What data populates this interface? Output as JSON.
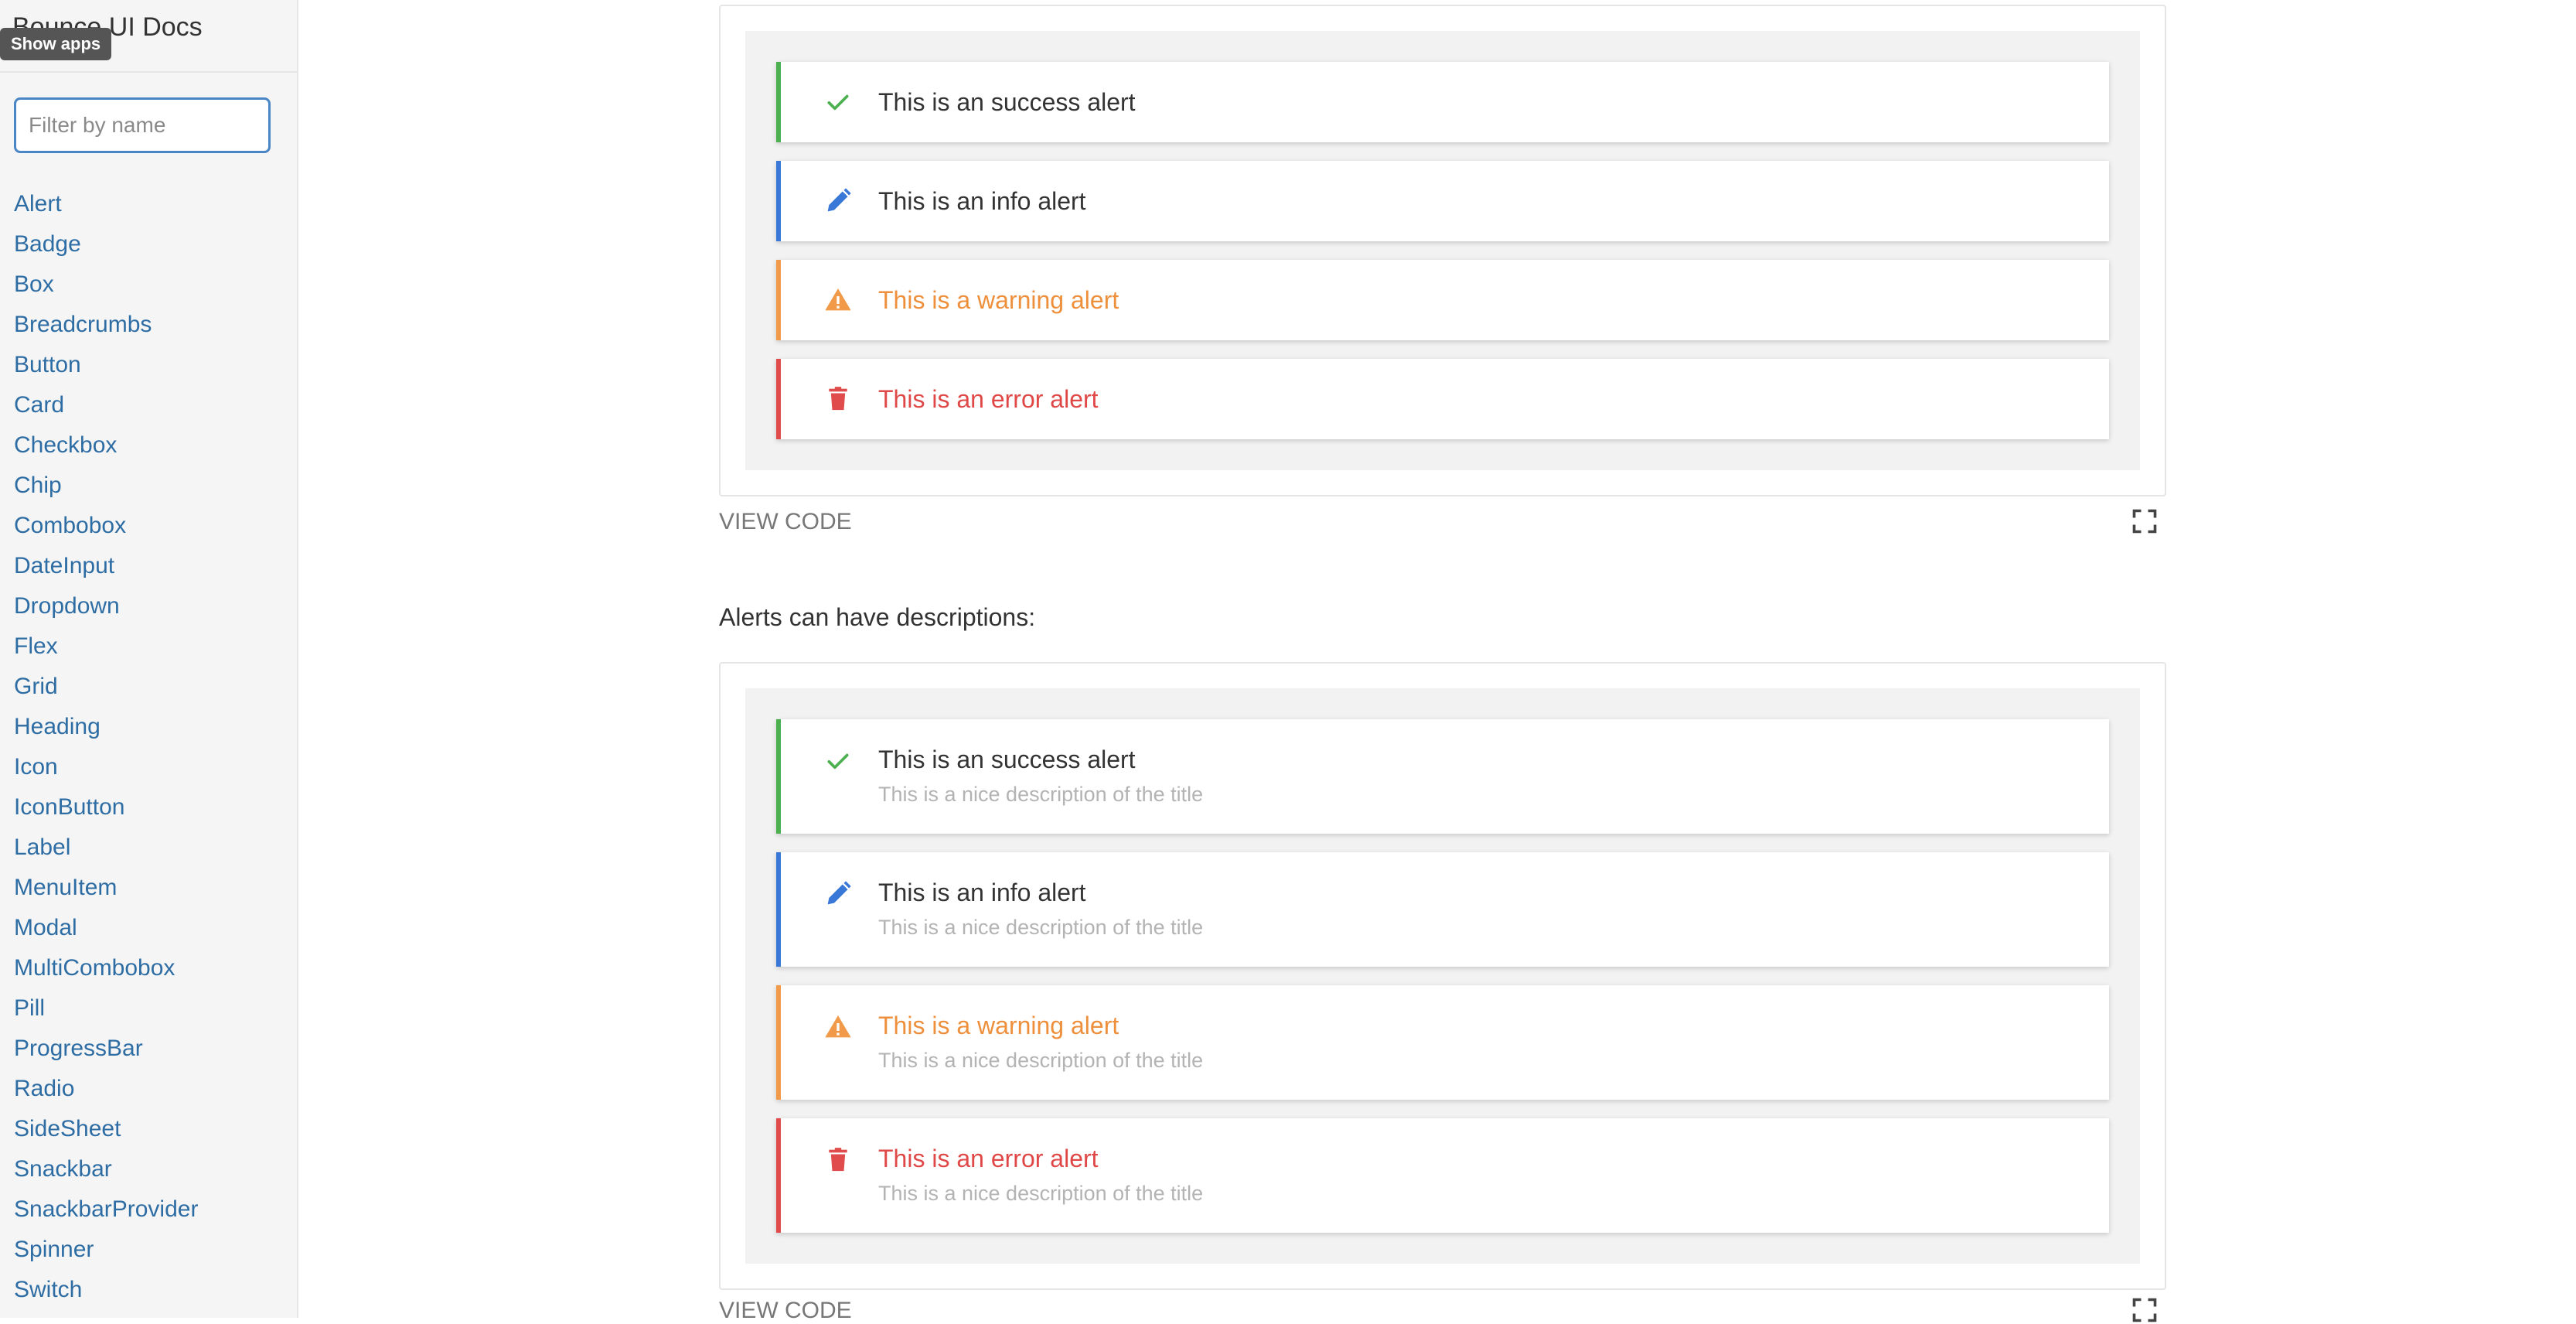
{
  "sidebar": {
    "brand": "Bounce UI Docs",
    "tooltip": "Show apps",
    "filter_placeholder": "Filter by name",
    "items": [
      "Alert",
      "Badge",
      "Box",
      "Breadcrumbs",
      "Button",
      "Card",
      "Checkbox",
      "Chip",
      "Combobox",
      "DateInput",
      "Dropdown",
      "Flex",
      "Grid",
      "Heading",
      "Icon",
      "IconButton",
      "Label",
      "MenuItem",
      "Modal",
      "MultiCombobox",
      "Pill",
      "ProgressBar",
      "Radio",
      "SideSheet",
      "Snackbar",
      "SnackbarProvider",
      "Spinner",
      "Switch"
    ]
  },
  "demo1": {
    "alerts": [
      {
        "type": "success",
        "icon": "check-icon",
        "title": "This is an success alert"
      },
      {
        "type": "info",
        "icon": "pencil-icon",
        "title": "This is an info alert"
      },
      {
        "type": "warning",
        "icon": "warning-icon",
        "title": "This is a warning alert"
      },
      {
        "type": "error",
        "icon": "trash-icon",
        "title": "This is an error alert"
      }
    ],
    "view_code": "VIEW CODE"
  },
  "section_text": "Alerts can have descriptions:",
  "demo2": {
    "alerts": [
      {
        "type": "success",
        "icon": "check-icon",
        "title": "This is an success alert",
        "description": "This is a nice description of the title"
      },
      {
        "type": "info",
        "icon": "pencil-icon",
        "title": "This is an info alert",
        "description": "This is a nice description of the title"
      },
      {
        "type": "warning",
        "icon": "warning-icon",
        "title": "This is a warning alert",
        "description": "This is a nice description of the title"
      },
      {
        "type": "error",
        "icon": "trash-icon",
        "title": "This is an error alert",
        "description": "This is a nice description of the title"
      }
    ],
    "view_code": "VIEW CODE"
  },
  "colors": {
    "link": "#2e6da4",
    "success": "#4caf50",
    "info": "#3a78d8",
    "warning": "#f09a4a",
    "error": "#e04c4c"
  }
}
